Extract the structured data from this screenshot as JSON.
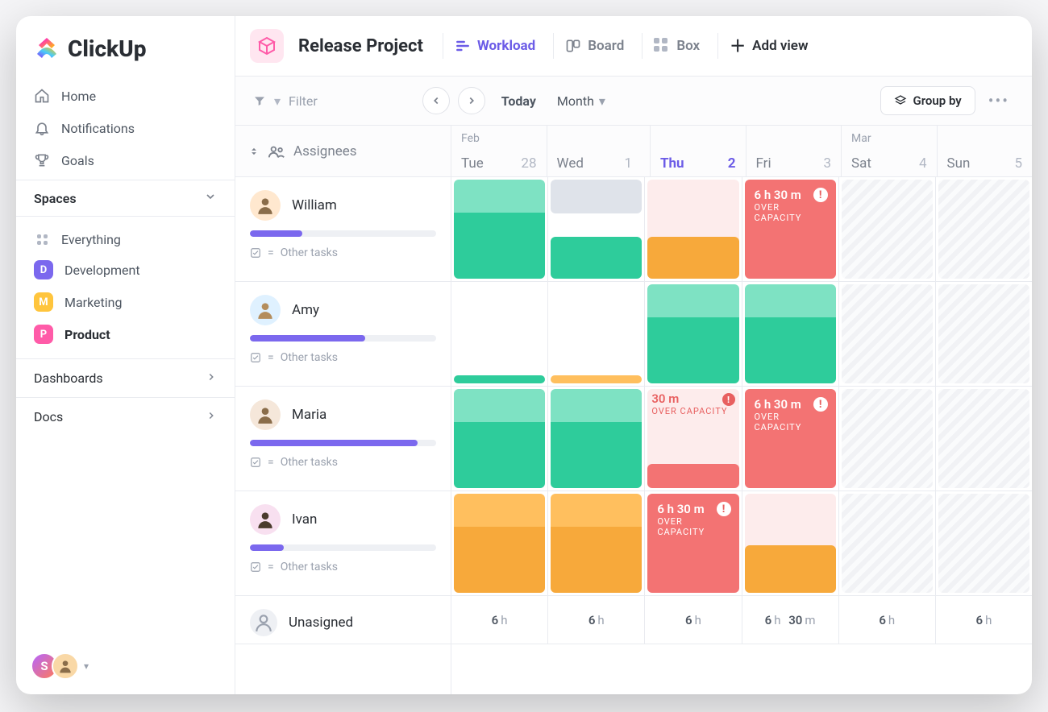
{
  "brand": "ClickUp",
  "nav": {
    "home": "Home",
    "notifications": "Notifications",
    "goals": "Goals"
  },
  "spaces": {
    "header": "Spaces",
    "everything": "Everything",
    "items": [
      {
        "letter": "D",
        "name": "Development",
        "color": "#7b68ee"
      },
      {
        "letter": "M",
        "name": "Marketing",
        "color": "#ffc53d"
      },
      {
        "letter": "P",
        "name": "Product",
        "color": "#ff5ba8",
        "active": true
      }
    ]
  },
  "secondary": {
    "dashboards": "Dashboards",
    "docs": "Docs"
  },
  "header": {
    "title": "Release Project",
    "tabs": {
      "workload": "Workload",
      "board": "Board",
      "box": "Box",
      "add_view": "Add view"
    }
  },
  "toolbar": {
    "filter": "Filter",
    "today": "Today",
    "range": "Month",
    "group_by": "Group by"
  },
  "columns": {
    "assignees_header": "Assignees",
    "days": [
      {
        "month": "Feb",
        "name": "Tue",
        "num": "28"
      },
      {
        "month": "",
        "name": "Wed",
        "num": "1"
      },
      {
        "month": "",
        "name": "Thu",
        "num": "2",
        "today": true
      },
      {
        "month": "",
        "name": "Fri",
        "num": "3"
      },
      {
        "month": "Mar",
        "name": "Sat",
        "num": "4"
      },
      {
        "month": "",
        "name": "Sun",
        "num": "5"
      }
    ]
  },
  "assignees": [
    {
      "name": "William",
      "progress": 28,
      "other_tasks": "Other tasks"
    },
    {
      "name": "Amy",
      "progress": 62,
      "other_tasks": "Other tasks"
    },
    {
      "name": "Maria",
      "progress": 90,
      "other_tasks": "Other tasks"
    },
    {
      "name": "Ivan",
      "progress": 18,
      "other_tasks": "Other tasks"
    }
  ],
  "unassigned_label": "Unasigned",
  "overcap": {
    "t1": "6 h 30 m",
    "t2": "30 m",
    "label": "OVER CAPACITY"
  },
  "footer_caps": [
    "6 h",
    "6 h",
    "6 h",
    "6 h 30 m",
    "6 h",
    "6 h"
  ]
}
